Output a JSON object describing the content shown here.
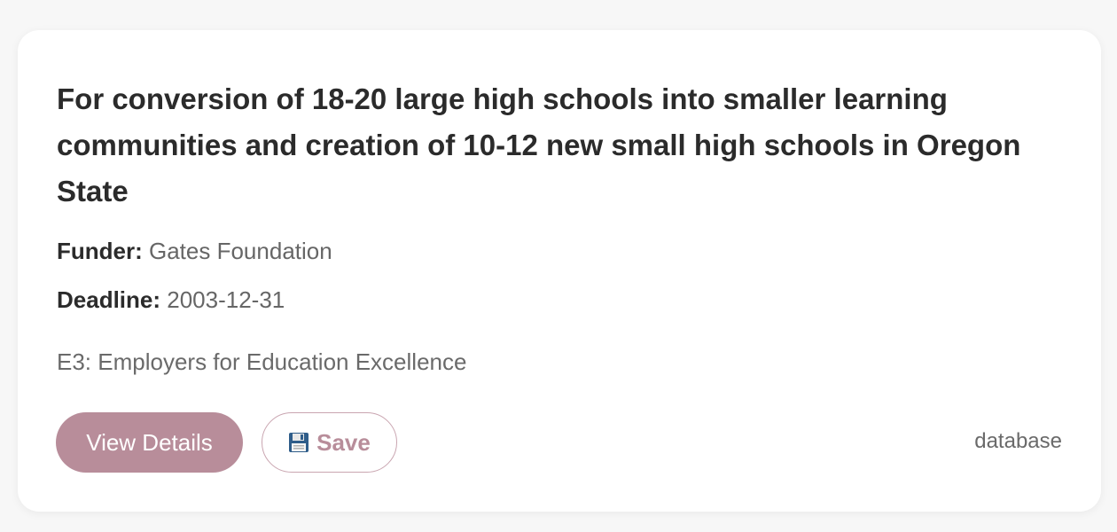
{
  "card": {
    "title": "For conversion of 18-20 large high schools into smaller learning communities and creation of 10-12 new small high schools in Oregon State",
    "funder_label": "Funder:",
    "funder_value": "Gates Foundation",
    "deadline_label": "Deadline:",
    "deadline_value": "2003-12-31",
    "organization": "E3: Employers for Education Excellence",
    "view_details_label": "View Details",
    "save_label": "Save",
    "save_icon": "floppy-disk-icon",
    "source_tag": "database"
  },
  "colors": {
    "accent": "#b88d9a",
    "title_text": "#2b2b2b",
    "muted_text": "#666666",
    "background": "#f7f7f7",
    "card": "#ffffff"
  }
}
